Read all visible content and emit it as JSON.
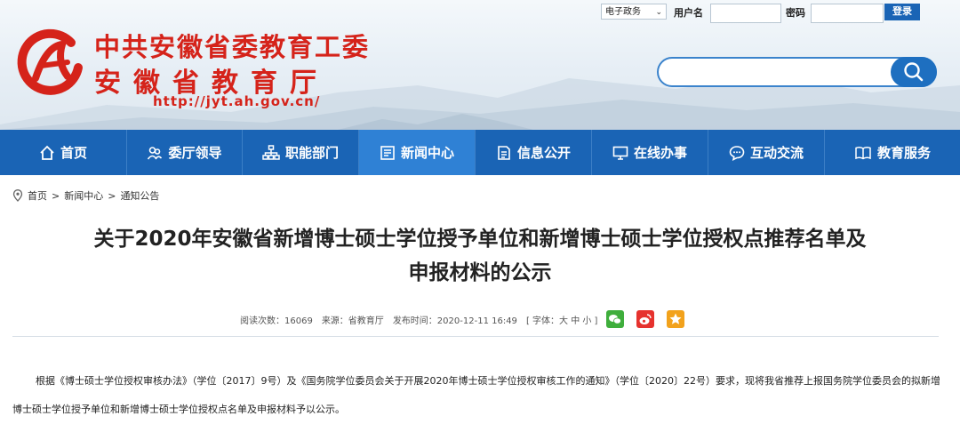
{
  "header": {
    "title_line1": "中共安徽省委教育工委",
    "title_line2": "安徽省教育厅",
    "url": "http://jyt.ah.gov.cn/",
    "colors": {
      "brand_red": "#d5231a",
      "nav_blue": "#1a64b5"
    }
  },
  "login": {
    "select_value": "电子政务",
    "user_label": "用户名",
    "password_label": "密码",
    "login_button": "登录"
  },
  "search": {
    "placeholder": ""
  },
  "nav": {
    "items": [
      {
        "label": "首页",
        "icon": "home-icon"
      },
      {
        "label": "委厅领导",
        "icon": "people-icon"
      },
      {
        "label": "职能部门",
        "icon": "org-icon"
      },
      {
        "label": "新闻中心",
        "icon": "news-icon"
      },
      {
        "label": "信息公开",
        "icon": "document-icon"
      },
      {
        "label": "在线办事",
        "icon": "monitor-icon"
      },
      {
        "label": "互动交流",
        "icon": "chat-icon"
      },
      {
        "label": "教育服务",
        "icon": "book-icon"
      }
    ]
  },
  "breadcrumb": {
    "items": [
      "首页",
      "新闻中心",
      "通知公告"
    ],
    "separator": ">"
  },
  "article": {
    "title_line1": "关于2020年安徽省新增博士硕士学位授予单位和新增博士硕士学位授权点推荐名单及",
    "title_line2": "申报材料的公示",
    "meta": {
      "read_count": "阅读次数：16069",
      "source": "来源：省教育厅",
      "publish_time": "发布时间：2020-12-11 16:49",
      "font_size": "[ 字体：大 中 小 ]"
    },
    "paragraph": "根据《博士硕士学位授权审核办法》（学位〔2017〕9号）及《国务院学位委员会关于开展2020年博士硕士学位授权审核工作的通知》（学位〔2020〕22号）要求，现将我省推荐上报国务院学位委员会的拟新增博士硕士学位授予单位和新增博士硕士学位授权点名单及申报材料予以公示。"
  }
}
